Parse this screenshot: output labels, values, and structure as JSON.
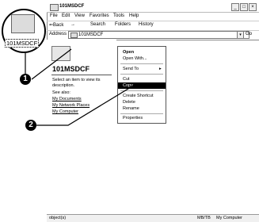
{
  "window": {
    "title": "101MSDCF",
    "controls": [
      "_",
      "□",
      "×"
    ]
  },
  "menubar": {
    "items": [
      "File",
      "Edit",
      "View",
      "Favorites",
      "Tools",
      "Help"
    ]
  },
  "toolbar": {
    "back": "⇐Back",
    "forward": "→",
    "search": "Search",
    "folders": "Folders",
    "history": "History"
  },
  "address": {
    "label": "Address",
    "value": "101MSDCF",
    "go": "Go"
  },
  "taskpane": {
    "title": "101MSDCF",
    "hint": "Select an item to view its description.",
    "see_also": "See also:",
    "links": [
      "My Documents",
      "My Network Places",
      "My Computer"
    ]
  },
  "context_menu": {
    "items": [
      "Open",
      "Open With...",
      "Send To",
      "Cut",
      "Copy",
      "Create Shortcut",
      "Delete",
      "Rename",
      "Properties"
    ],
    "send_to_arrow": "▸",
    "selected": "Copy"
  },
  "statusbar": {
    "objects": "object(s)",
    "size": "MB/TB",
    "location": "My Computer"
  },
  "zoom": {
    "label": "101MSDCF"
  },
  "callouts": {
    "one": "1",
    "two": "2"
  }
}
